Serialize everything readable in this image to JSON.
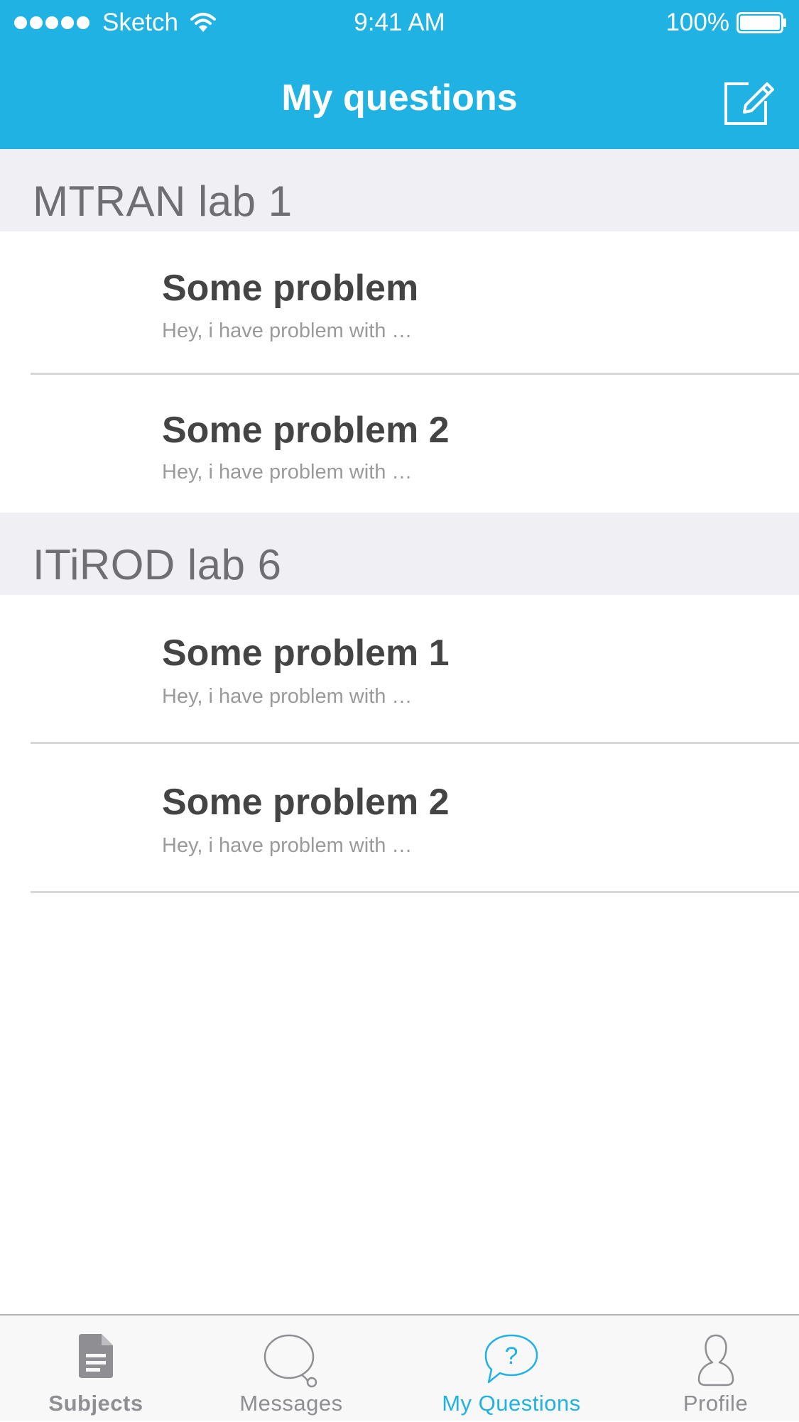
{
  "status_bar": {
    "carrier": "Sketch",
    "time": "9:41 AM",
    "battery": "100%"
  },
  "nav": {
    "title": "My questions",
    "compose_icon": "compose-icon"
  },
  "sections": [
    {
      "title": "MTRAN lab 1",
      "rows": [
        {
          "title": "Some problem",
          "subtitle": "Hey, i have problem with …"
        },
        {
          "title": "Some problem 2",
          "subtitle": "Hey, i have problem with …"
        }
      ]
    },
    {
      "title": "ITiROD lab 6",
      "rows": [
        {
          "title": "Some problem 1",
          "subtitle": "Hey, i have problem with …"
        },
        {
          "title": "Some problem 2",
          "subtitle": "Hey, i have problem with …"
        }
      ]
    }
  ],
  "tab_bar": {
    "tabs": [
      {
        "label": "Subjects",
        "icon": "document-icon",
        "active": false
      },
      {
        "label": "Messages",
        "icon": "chat-bubble-icon",
        "active": false
      },
      {
        "label": "My Questions",
        "icon": "question-bubble-icon",
        "active": true
      },
      {
        "label": "Profile",
        "icon": "person-icon",
        "active": false
      }
    ]
  },
  "colors": {
    "accent": "#1fb2e2",
    "section_background": "#efeff4",
    "title_text": "#444444",
    "subtitle_text": "#9a9a9a",
    "inactive_tab": "#8e8e93"
  }
}
